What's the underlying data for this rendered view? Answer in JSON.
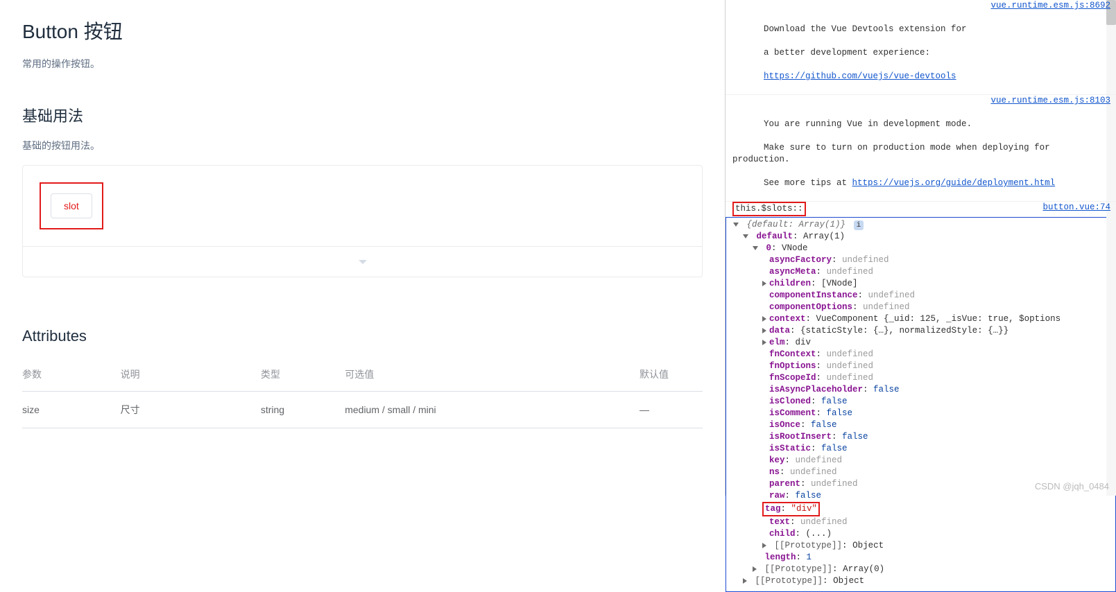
{
  "docs": {
    "title": "Button 按钮",
    "subtitle": "常用的操作按钮。",
    "basic": {
      "heading": "基础用法",
      "desc": "基础的按钮用法。",
      "slot_label": "slot"
    },
    "attributes": {
      "heading": "Attributes",
      "cols": {
        "param": "参数",
        "desc": "说明",
        "type": "类型",
        "opts": "可选值",
        "def": "默认值"
      },
      "rows": [
        {
          "param": "size",
          "desc": "尺寸",
          "type": "string",
          "opts": "medium / small / mini",
          "def": "—"
        }
      ]
    }
  },
  "console": {
    "msg1": {
      "text_a": "Download the Vue Devtools extension for ",
      "text_b": "a better development experience:",
      "link": "https://github.com/vuejs/vue-devtools",
      "src_a": "vue.runtime.esm.js:8692"
    },
    "msg2": {
      "line1": "You are running Vue in development mode.",
      "line2": "Make sure to turn on production mode when deploying for production.",
      "line3_a": "See more tips at ",
      "line3_link": "https://vuejs.org/guide/deployment.html",
      "src": "vue.runtime.esm.js:8103"
    },
    "log_label": "this.$slots::",
    "log_src": "button.vue:74",
    "tree": {
      "root_summary": "{default: Array(1)}",
      "default_label": "default",
      "default_val": "Array(1)",
      "idx0_label": "0",
      "idx0_val": "VNode",
      "props": [
        {
          "k": "asyncFactory",
          "v": "undefined",
          "t": "undef"
        },
        {
          "k": "asyncMeta",
          "v": "undefined",
          "t": "undef"
        },
        {
          "k": "children",
          "v": "[VNode]",
          "t": "obj",
          "exp": true
        },
        {
          "k": "componentInstance",
          "v": "undefined",
          "t": "undef"
        },
        {
          "k": "componentOptions",
          "v": "undefined",
          "t": "undef"
        },
        {
          "k": "context",
          "v": "VueComponent {_uid: 125, _isVue: true, $options",
          "t": "obj",
          "exp": true
        },
        {
          "k": "data",
          "v": "{staticStyle: {…}, normalizedStyle: {…}}",
          "t": "obj",
          "exp": true
        },
        {
          "k": "elm",
          "v": "div",
          "t": "obj",
          "exp": true
        },
        {
          "k": "fnContext",
          "v": "undefined",
          "t": "undef"
        },
        {
          "k": "fnOptions",
          "v": "undefined",
          "t": "undef"
        },
        {
          "k": "fnScopeId",
          "v": "undefined",
          "t": "undef"
        },
        {
          "k": "isAsyncPlaceholder",
          "v": "false",
          "t": "bool"
        },
        {
          "k": "isCloned",
          "v": "false",
          "t": "bool"
        },
        {
          "k": "isComment",
          "v": "false",
          "t": "bool"
        },
        {
          "k": "isOnce",
          "v": "false",
          "t": "bool"
        },
        {
          "k": "isRootInsert",
          "v": "false",
          "t": "bool"
        },
        {
          "k": "isStatic",
          "v": "false",
          "t": "bool"
        },
        {
          "k": "key",
          "v": "undefined",
          "t": "undef"
        },
        {
          "k": "ns",
          "v": "undefined",
          "t": "undef"
        },
        {
          "k": "parent",
          "v": "undefined",
          "t": "undef"
        },
        {
          "k": "raw",
          "v": "false",
          "t": "bool"
        }
      ],
      "tag_k": "tag",
      "tag_v": "\"div\"",
      "tail": [
        {
          "k": "text",
          "v": "undefined",
          "t": "undef"
        },
        {
          "k": "child",
          "v": "(...)",
          "t": "obj"
        }
      ],
      "proto_inner": "[[Prototype]]",
      "proto_inner_v": "Object",
      "length_k": "length",
      "length_v": "1",
      "proto_mid": "[[Prototype]]",
      "proto_mid_v": "Array(0)",
      "proto_outer": "[[Prototype]]",
      "proto_outer_v": "Object"
    }
  },
  "watermark": "CSDN @jqh_0484"
}
